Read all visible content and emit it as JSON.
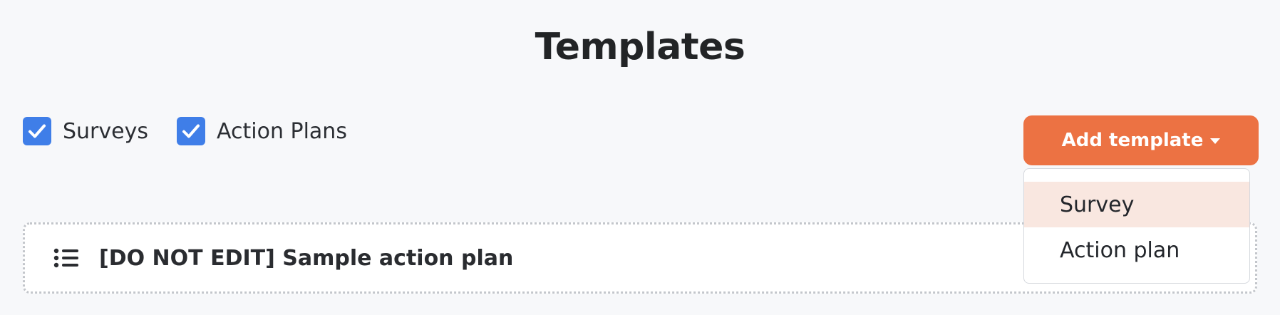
{
  "page": {
    "title": "Templates"
  },
  "filters": [
    {
      "label": "Surveys",
      "checked": true
    },
    {
      "label": "Action Plans",
      "checked": true
    }
  ],
  "add_template": {
    "label": "Add template",
    "menu": [
      {
        "label": "Survey",
        "highlighted": true
      },
      {
        "label": "Action plan",
        "highlighted": false
      }
    ]
  },
  "templates": [
    {
      "title": "[DO NOT EDIT] Sample action plan",
      "icon": "list-icon"
    }
  ],
  "colors": {
    "accent": "#ec7243",
    "checkbox": "#3f7ee8",
    "menu_highlight": "#f9e7e0"
  }
}
